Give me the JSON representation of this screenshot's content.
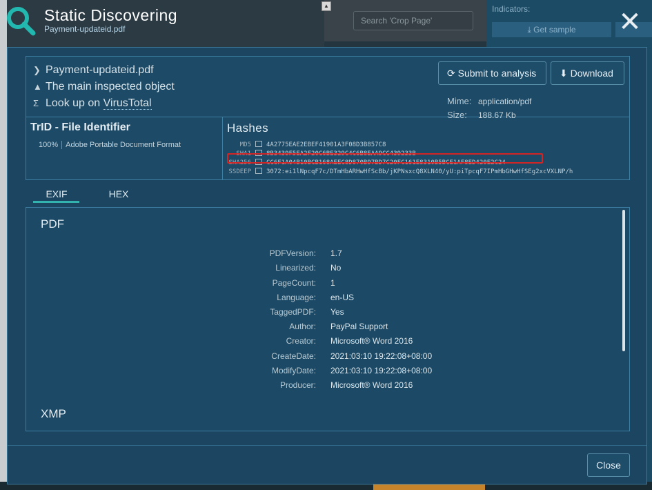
{
  "header": {
    "title": "Static Discovering",
    "subtitle": "Payment-updateid.pdf"
  },
  "background": {
    "search_placeholder": "Search 'Crop Page'",
    "indicators_label": "Indicators:",
    "get_sample_label": "Get sample"
  },
  "info": {
    "filename": "Payment-updateid.pdf",
    "inspected_note": "The main inspected object",
    "lookup_prefix": "Look up on",
    "lookup_link": "VirusTotal",
    "submit_label": "Submit to analysis",
    "download_label": "Download",
    "mime_key": "Mime:",
    "mime_value": "application/pdf",
    "size_key": "Size:",
    "size_value": "188.67 Kb"
  },
  "trid": {
    "title": "TrID - File Identifier",
    "percent": "100%",
    "format": "Adobe Portable Document Format"
  },
  "hashes": {
    "title": "Hashes",
    "rows": [
      {
        "key": "MD5",
        "value": "4A2775EAE2EBEF41901A3F08D3B857C8"
      },
      {
        "key": "SHA1",
        "value": "8B3439F5EA2F20C6BE329C4C6B8EAA9CC439233B"
      },
      {
        "key": "SHA256",
        "value": "CC6F1A04B10BCB168AEEC8D870B97BD7C20FC161E8310B5BCE1AF8ED420E2C24"
      },
      {
        "key": "SSDEEP",
        "value": "3072:ei1lNpcqF7c/DTmHbARHwHfScBb/jKPNsxcQ8XLN40/yU:piTpcqF7IPmHbGHwHfSEg2xcVXLNP/h"
      }
    ]
  },
  "tabs": {
    "exif": "EXIF",
    "hex": "HEX"
  },
  "exif": {
    "pdf_title": "PDF",
    "xmp_title": "XMP",
    "rows": [
      {
        "key": "PDFVersion:",
        "value": "1.7"
      },
      {
        "key": "Linearized:",
        "value": "No"
      },
      {
        "key": "PageCount:",
        "value": "1"
      },
      {
        "key": "Language:",
        "value": "en-US"
      },
      {
        "key": "TaggedPDF:",
        "value": "Yes"
      },
      {
        "key": "Author:",
        "value": "PayPal Support"
      },
      {
        "key": "Creator:",
        "value": "Microsoft® Word 2016"
      },
      {
        "key": "CreateDate:",
        "value": "2021:03:10 19:22:08+08:00"
      },
      {
        "key": "ModifyDate:",
        "value": "2021:03:10 19:22:08+08:00"
      },
      {
        "key": "Producer:",
        "value": "Microsoft® Word 2016"
      }
    ]
  },
  "footer": {
    "close_label": "Close"
  },
  "colors": {
    "accent": "#34b2ad",
    "modal_bg": "#1b4560",
    "highlight": "#d42424"
  }
}
